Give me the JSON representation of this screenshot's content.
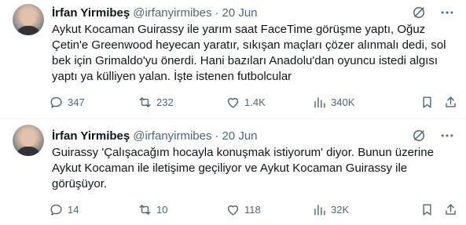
{
  "tweets": [
    {
      "author_name": "İrfan Yirmibeş",
      "handle": "@irfanyirmibes",
      "separator": "·",
      "date": "20 Jun",
      "lines": [
        "Aykut Kocaman Guirassy ile yarım saat FaceTime görüşme yaptı, Oğuz",
        "Çetin'e Greenwood heyecan yaratır, sıkışan maçları çözer alınmalı dedi, sol",
        "bek için Grimaldo'yu önerdi. Hani bazıları Anadolu'dan oyuncu istedi algısı",
        "yaptı ya külliyen yalan. İşte istenen futbolcular"
      ],
      "replies": "347",
      "retweets": "232",
      "likes": "1.4K",
      "views": "340K"
    },
    {
      "author_name": "İrfan Yirmibeş",
      "handle": "@irfanyirmibes",
      "separator": "·",
      "date": "20 Jun",
      "lines": [
        "Guirassy 'Çalışacağım hocayla konuşmak istiyorum' diyor. Bunun üzerine",
        "Aykut Kocaman ile iletişime geçiliyor ve Aykut Kocaman Guirassy ile",
        "görüşüyor."
      ],
      "replies": "14",
      "retweets": "10",
      "likes": "118",
      "views": "32K"
    }
  ],
  "icons": {
    "header": [
      "grok-icon",
      "more-icon"
    ],
    "actions": [
      "reply-icon",
      "retweet-icon",
      "like-icon",
      "views-icon",
      "bookmark-icon",
      "share-icon"
    ]
  },
  "colors": {
    "text": "#0f1419",
    "secondary": "#536471",
    "divider": "#eff3f4",
    "background": "#ffffff"
  }
}
